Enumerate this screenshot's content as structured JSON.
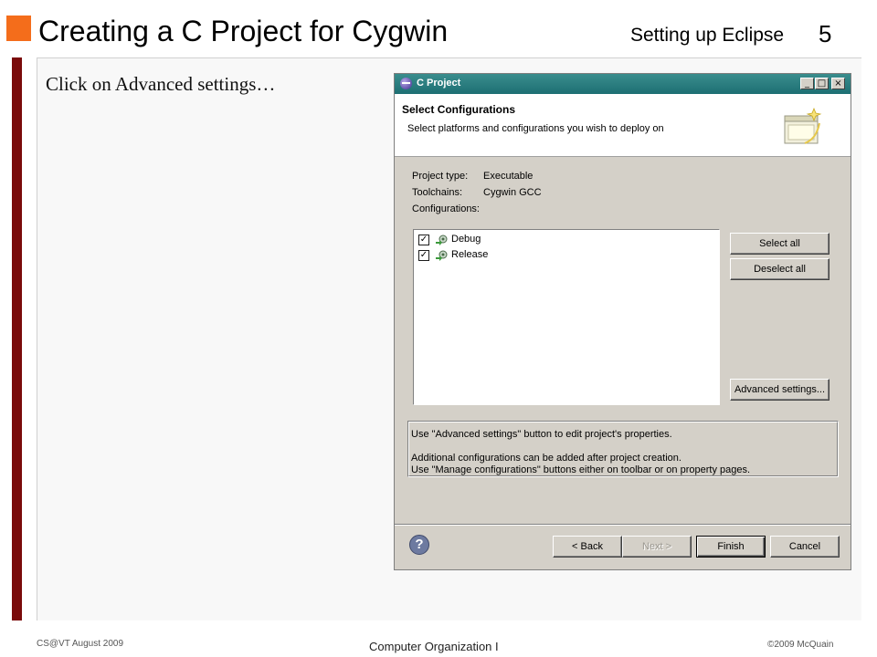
{
  "slide": {
    "title": "Creating a C Project for Cygwin",
    "section": "Setting up Eclipse",
    "number": "5",
    "instruction": "Click on Advanced settings…",
    "footer_left": "CS@VT August 2009",
    "footer_center": "Computer Organization I",
    "footer_right": "©2009  McQuain"
  },
  "dialog": {
    "title": "C Project",
    "window_buttons": {
      "minimize": "_",
      "maximize": "□",
      "close": "×"
    },
    "header": {
      "title": "Select Configurations",
      "subtitle": "Select platforms and configurations you wish to deploy on"
    },
    "fields": {
      "project_type_label": "Project type:",
      "project_type_value": "Executable",
      "toolchains_label": "Toolchains:",
      "toolchains_value": "Cygwin GCC",
      "configurations_label": "Configurations:"
    },
    "configurations": [
      {
        "name": "Debug",
        "checked": true
      },
      {
        "name": "Release",
        "checked": true
      }
    ],
    "buttons": {
      "select_all": "Select all",
      "deselect_all": "Deselect all",
      "advanced_settings": "Advanced settings...",
      "back": "< Back",
      "next": "Next >",
      "finish": "Finish",
      "cancel": "Cancel"
    },
    "info": {
      "line1": "Use \"Advanced settings\" button to edit project's properties.",
      "line2": "Additional configurations can be added after project creation.",
      "line3": "Use \"Manage configurations\" buttons either on toolbar or on property pages."
    },
    "help_symbol": "?"
  },
  "colors": {
    "accent_orange": "#f46d1b",
    "sidebar_maroon": "#7a0a0a",
    "titlebar_teal": "#1d6f73",
    "dialog_gray": "#d4d0c8"
  }
}
